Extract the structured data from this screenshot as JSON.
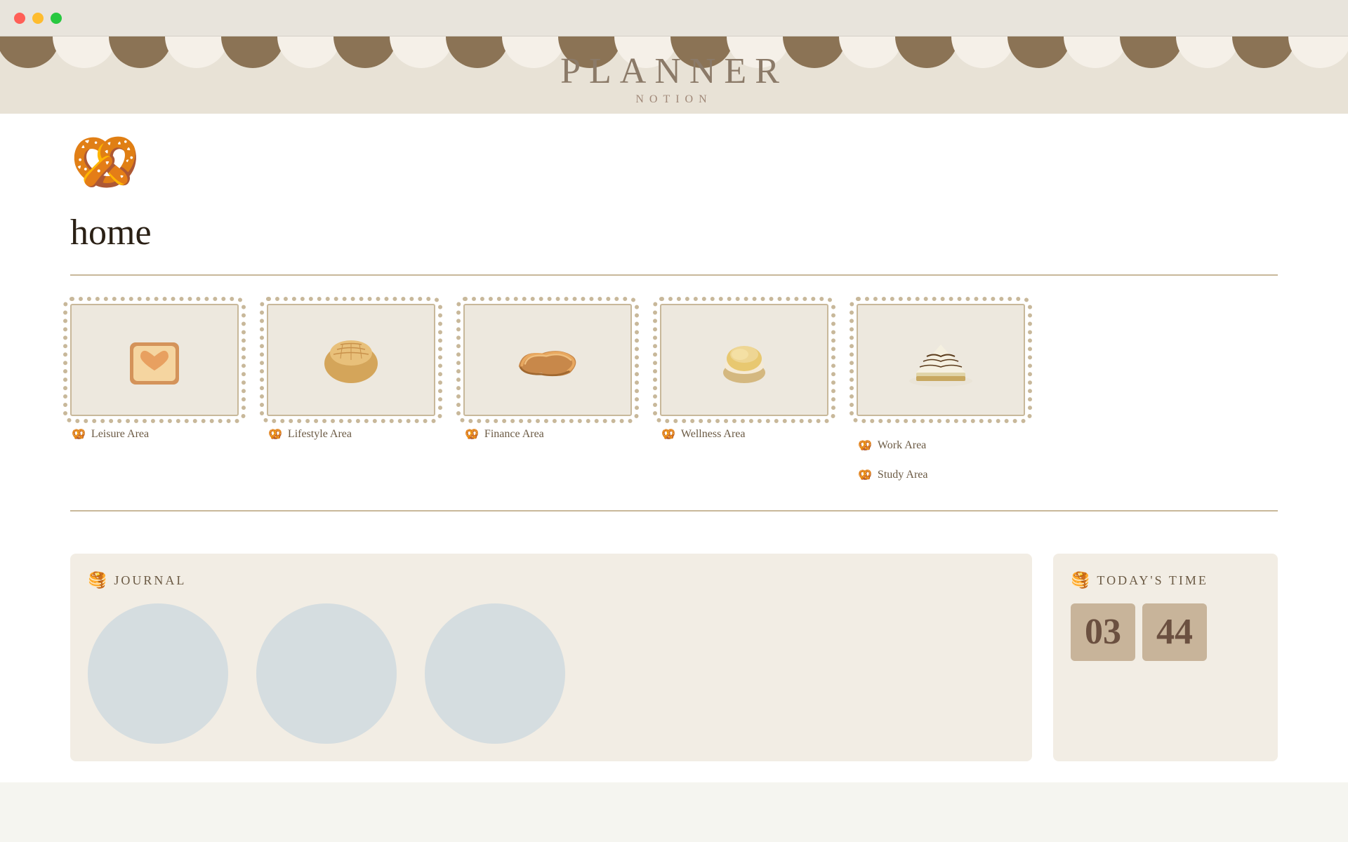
{
  "window": {
    "traffic_lights": [
      "red",
      "yellow",
      "green"
    ]
  },
  "header": {
    "title": "PLANNER",
    "subtitle": "NOTION"
  },
  "page": {
    "home_label": "home",
    "pretzel_emoji": "🥨"
  },
  "cards": [
    {
      "id": "leisure",
      "label": "Leisure Area",
      "food_emoji": "🍞",
      "food_alt": "toast with heart"
    },
    {
      "id": "lifestyle",
      "label": "Lifestyle Area",
      "food_emoji": "🍞",
      "food_alt": "melon pan bread"
    },
    {
      "id": "finance",
      "label": "Finance Area",
      "food_emoji": "🥐",
      "food_alt": "croissant"
    },
    {
      "id": "wellness",
      "label": "Wellness Area",
      "food_emoji": "🧁",
      "food_alt": "cream puff"
    },
    {
      "id": "work",
      "labels": [
        "Work Area",
        "Study Area"
      ],
      "food_emoji": "🍰",
      "food_alt": "cheesecake slice"
    }
  ],
  "sections": {
    "journal": {
      "icon": "🥞",
      "title": "JOURNAL"
    },
    "todays_time": {
      "icon": "🥞",
      "title": "TODAY'S TIME",
      "hour": "03",
      "minute": "44"
    }
  },
  "colors": {
    "background": "#e8e2d6",
    "card_bg": "#ede8de",
    "card_border": "#c8b89a",
    "text_primary": "#6b5a44",
    "text_dark": "#2a2015",
    "awning_brown": "#8b7355",
    "awning_cream": "#f5f0e8",
    "divider": "#c8b89a"
  }
}
